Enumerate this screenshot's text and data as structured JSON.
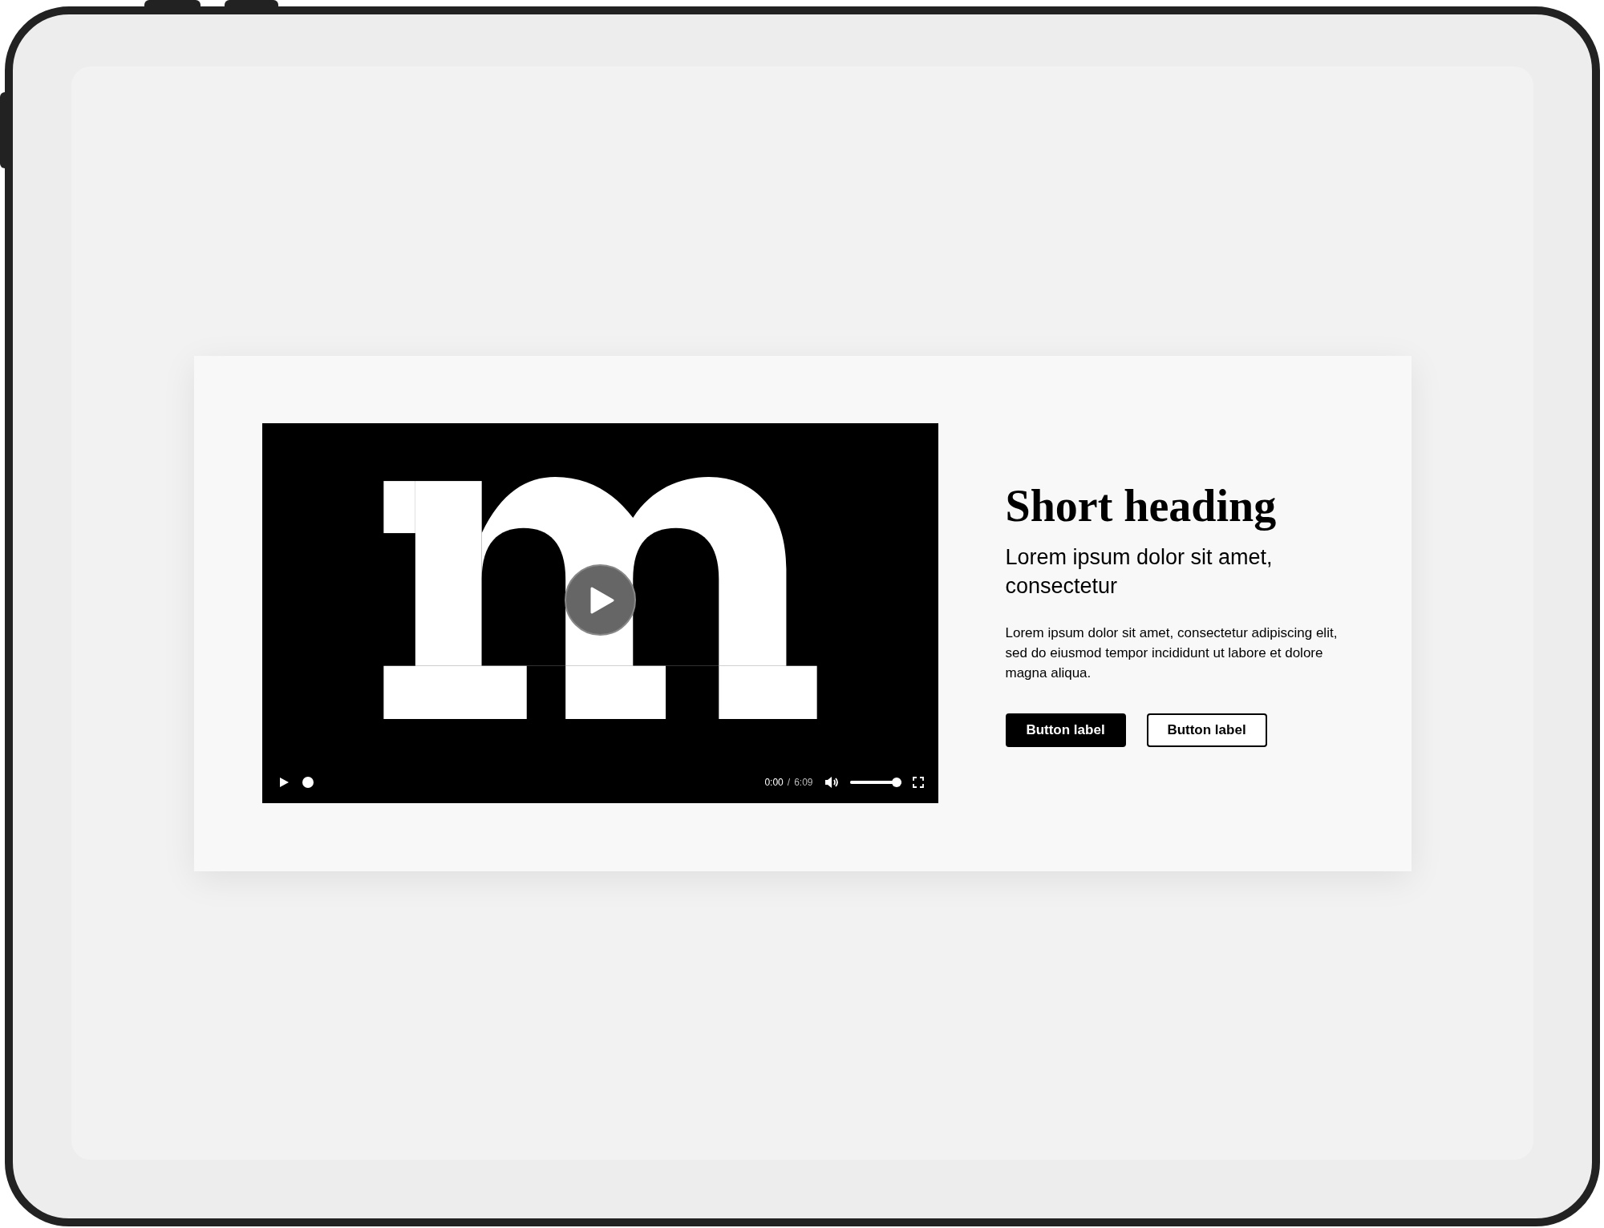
{
  "video": {
    "progress": {
      "level": 0
    },
    "current_time": "0:00",
    "separator": "/",
    "duration": "6:09",
    "volume": {
      "level": 1
    }
  },
  "content": {
    "heading": "Short heading",
    "subheading": "Lorem ipsum dolor sit amet, consectetur",
    "body": "Lorem ipsum dolor sit amet, consectetur adipiscing elit, sed do eiusmod tempor incididunt ut labore et dolore magna aliqua.",
    "buttons": [
      {
        "label": "Button label",
        "kind": "primary"
      },
      {
        "label": "Button label",
        "kind": "secondary"
      }
    ]
  }
}
